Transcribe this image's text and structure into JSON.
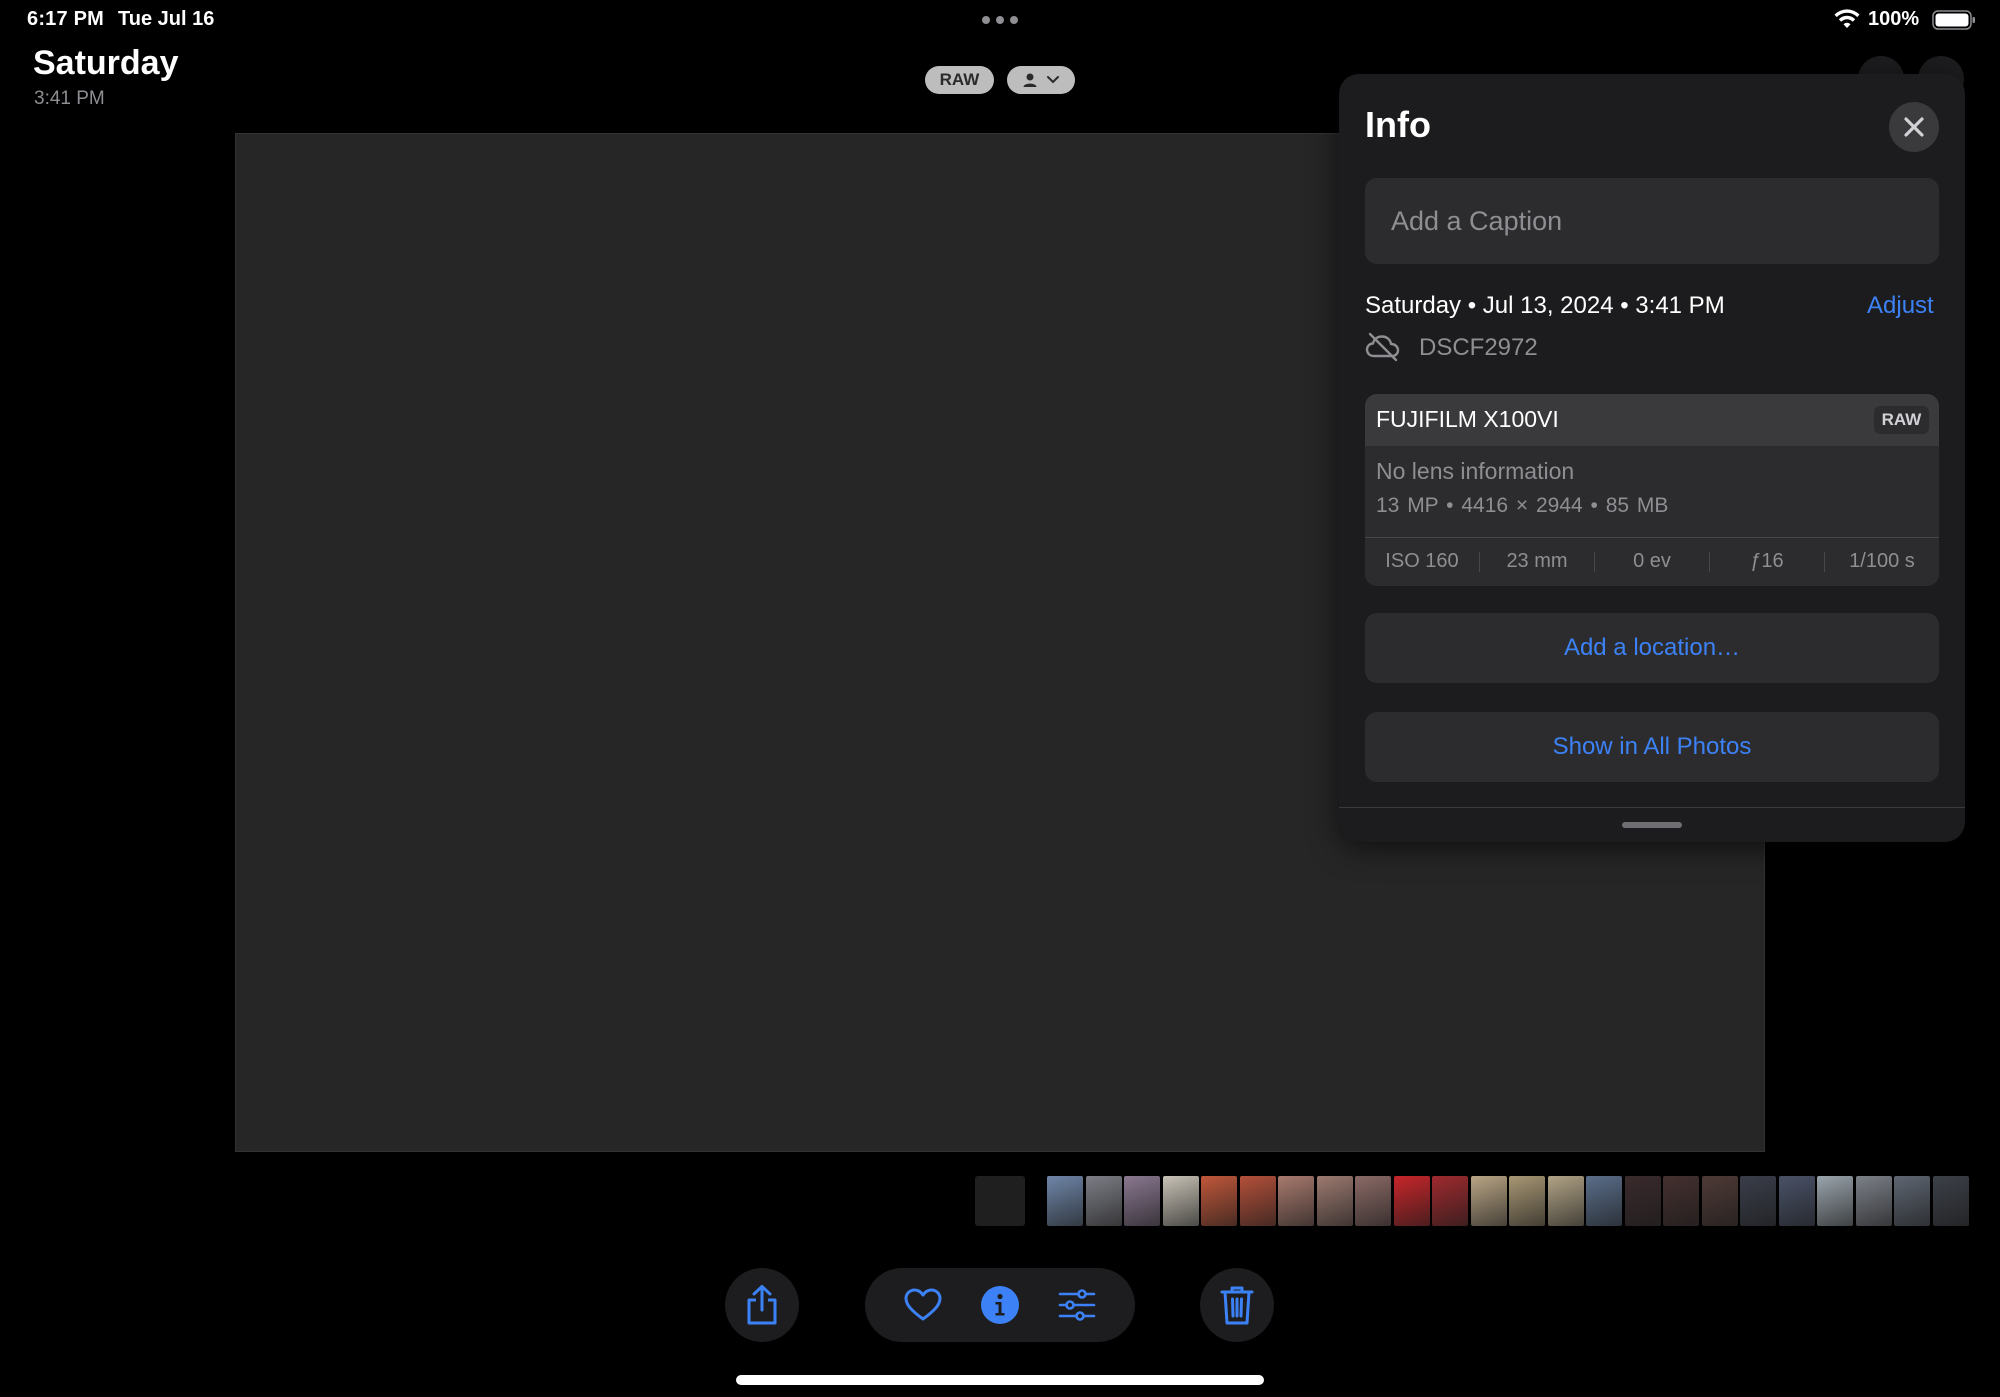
{
  "status": {
    "time": "6:17 PM",
    "date": "Tue Jul 16",
    "battery": "100%"
  },
  "header": {
    "title": "Saturday",
    "subtitle": "3:41 PM",
    "raw_pill": "RAW"
  },
  "info": {
    "title": "Info",
    "caption_placeholder": "Add a Caption",
    "date_line": "Saturday • Jul 13, 2024 • 3:41 PM",
    "adjust_label": "Adjust",
    "filename": "DSCF2972",
    "camera": "FUJIFILM X100VI",
    "raw_badge": "RAW",
    "lens": "No lens information",
    "specs": "13 MP  •  4416 × 2944  •  85 MB",
    "exif": {
      "iso": "ISO 160",
      "focal": "23 mm",
      "ev": "0 ev",
      "aperture": "ƒ16",
      "shutter": "1/100 s"
    },
    "location_label": "Add a location…",
    "show_all_label": "Show in All Photos"
  },
  "colors": {
    "accent": "#3c82f6",
    "panel_bg": "#1c1c1e",
    "card_bg": "#2c2c2e"
  },
  "icons": [
    "wifi-icon",
    "battery-icon",
    "person-icon",
    "chevron-down-icon",
    "close-icon",
    "cloud-off-icon",
    "share-icon",
    "heart-icon",
    "info-icon",
    "sliders-icon",
    "trash-icon"
  ],
  "filmstrip": {
    "thumbs": [
      "#6f86a8",
      "#7d7e86",
      "#8a7890",
      "#c8c2b6",
      "#c0573a",
      "#b3503a",
      "#a87a6e",
      "#9c7a70",
      "#8b6a66",
      "#c7262a",
      "#9e2a2e",
      "#b9a585",
      "#a89774",
      "#b1a386",
      "#5a6e8a",
      "#3a2a2c",
      "#44302f",
      "#4e3a36",
      "#3a3e4a",
      "#4a5268",
      "#9aa4ac",
      "#7c8088",
      "#5e6672",
      "#3c4048"
    ]
  }
}
